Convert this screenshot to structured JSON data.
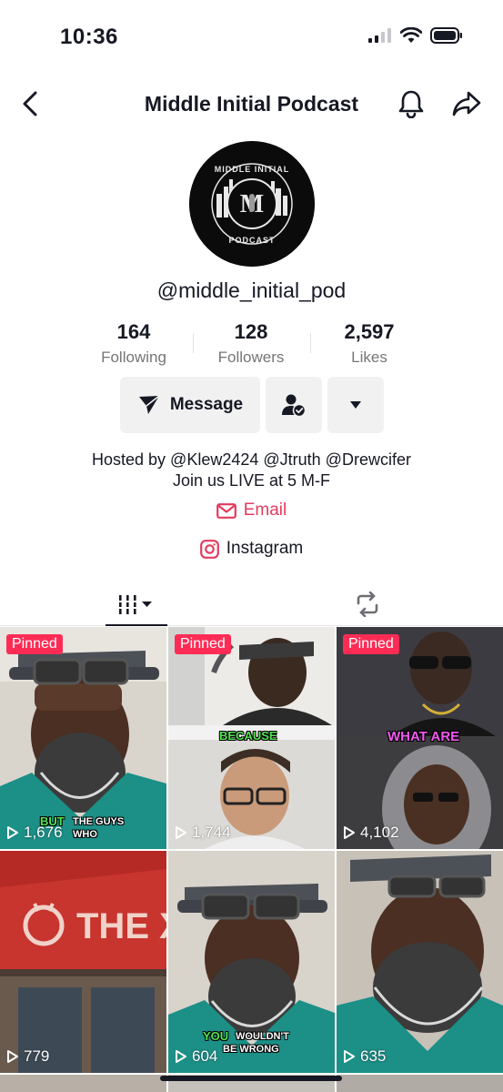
{
  "status_bar": {
    "time": "10:36"
  },
  "header": {
    "title": "Middle Initial Podcast"
  },
  "profile": {
    "username": "@middle_initial_pod",
    "stats": [
      {
        "num": "164",
        "label": "Following"
      },
      {
        "num": "128",
        "label": "Followers"
      },
      {
        "num": "2,597",
        "label": "Likes"
      }
    ],
    "message_label": "Message",
    "bio_line1": "Hosted by @Klew2424 @Jtruth @Drewcifer",
    "bio_line2": "Join us LIVE at 5 M-F",
    "email_label": "Email",
    "instagram_label": "Instagram",
    "avatar_text": "MIDDLE INITIAL PODCAST"
  },
  "videos": [
    {
      "pinned": "Pinned",
      "views": "1,676",
      "caption_a": "BUT",
      "caption_b": "THE GUYS",
      "caption_c": "WHO"
    },
    {
      "pinned": "Pinned",
      "views": "1,744",
      "caption_a": "BECAUSE"
    },
    {
      "pinned": "Pinned",
      "views": "4,102",
      "caption_a": "WHAT ARE"
    },
    {
      "views": "779",
      "caption_a": "THE XP"
    },
    {
      "views": "604",
      "caption_a": "YOU",
      "caption_b": "WOULDN'T",
      "caption_c": "BE WRONG"
    },
    {
      "views": "635"
    }
  ],
  "colors": {
    "accent": "#fe2c55",
    "email": "#e33b5e",
    "text": "#161823",
    "muted": "#757575"
  }
}
